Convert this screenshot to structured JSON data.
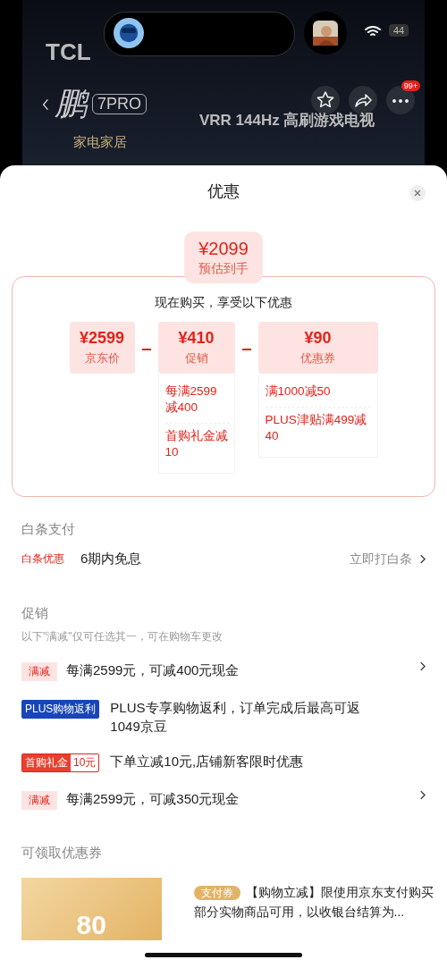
{
  "header": {
    "brand": "TCL",
    "brand_sub": "鹏",
    "model_badge": "7PRO",
    "tagline": "VRR 144Hz 高刷游戏电视",
    "event_label": "家电家居",
    "more_badge": "99+",
    "battery": "44"
  },
  "sheet": {
    "title": "优惠"
  },
  "estimate": {
    "price": "¥2099",
    "label": "预估到手"
  },
  "breakdown": {
    "heading": "现在购买，享受以下优惠",
    "items": [
      {
        "amount": "¥2599",
        "label": "京东价"
      },
      {
        "amount": "¥410",
        "label": "促销",
        "details": [
          "每满2599减400",
          "首购礼金减10"
        ]
      },
      {
        "amount": "¥90",
        "label": "优惠券",
        "details": [
          "满1000减50",
          "PLUS津贴满499减40"
        ]
      }
    ]
  },
  "baitiao": {
    "heading": "白条支付",
    "tag": "白条优惠",
    "text": "6期内免息",
    "action": "立即打白条"
  },
  "promotions": {
    "heading": "促销",
    "note": "以下\"满减\"仅可任选其一，可在购物车更改",
    "items": [
      {
        "kind": "plain",
        "tag": "满减",
        "text": "每满2599元，可减400元现金",
        "has_arrow": true
      },
      {
        "kind": "plus",
        "tag": "PLUS购物返利",
        "text": "PLUS专享购物返利，订单完成后最高可返1049京豆",
        "has_arrow": false
      },
      {
        "kind": "split",
        "tag": "首购礼金",
        "tag_extra": "10元",
        "text": "下单立减10元,店铺新客限时优惠",
        "has_arrow": false
      },
      {
        "kind": "plain",
        "tag": "满减",
        "text": "每满2599元，可减350元现金",
        "has_arrow": true
      }
    ]
  },
  "coupons": {
    "heading": "可领取优惠券",
    "items": [
      {
        "amount": "80",
        "tag": "支付券",
        "text": "【购物立减】限使用京东支付购买部分实物商品可用，以收银台结算为..."
      }
    ]
  }
}
